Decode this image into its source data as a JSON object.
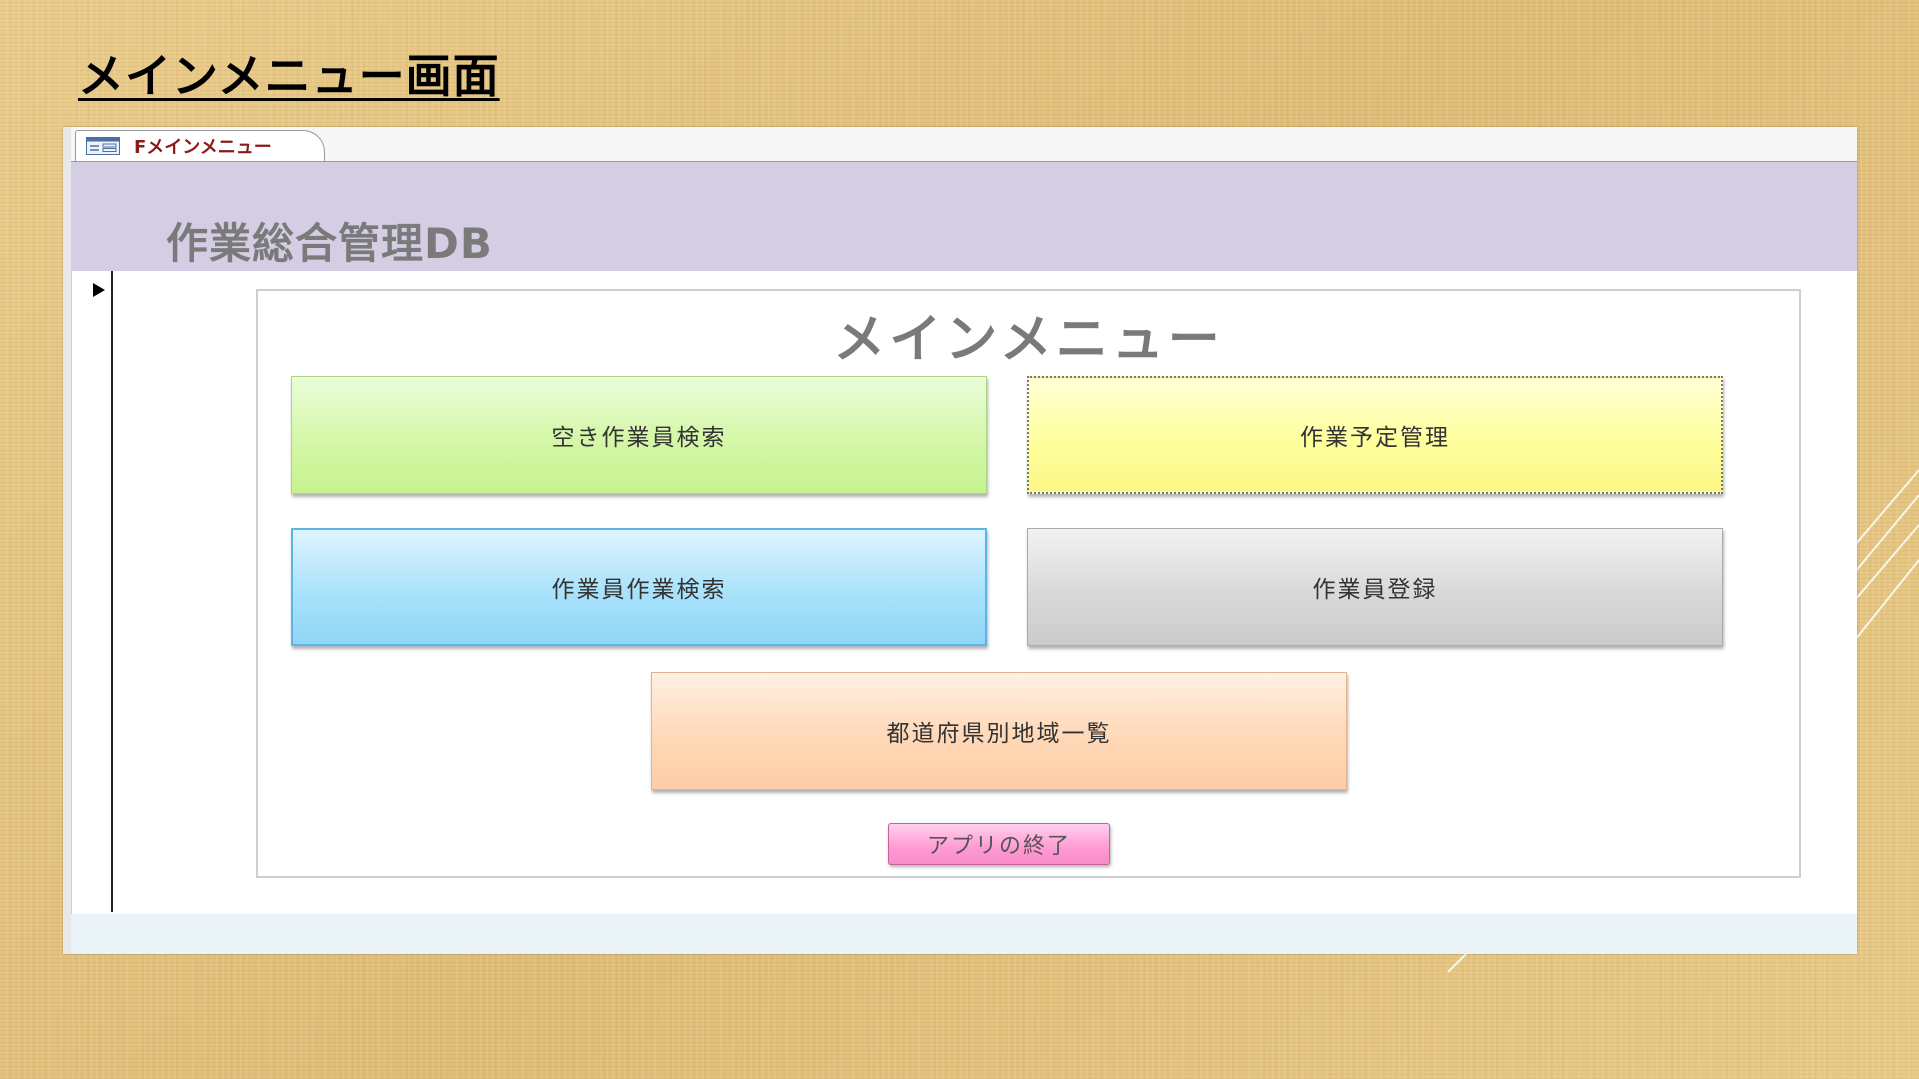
{
  "slide": {
    "title": "メインメニュー画面"
  },
  "window": {
    "tab_label": "Fメインメニュー",
    "app_title": "作業総合管理DB"
  },
  "menu": {
    "title": "メインメニュー",
    "buttons": [
      {
        "label": "空き作業員検索",
        "color": "#d4f7a8"
      },
      {
        "label": "作業予定管理",
        "color": "#ffff9e"
      },
      {
        "label": "作業員作業検索",
        "color": "#a9e2fb"
      },
      {
        "label": "作業員登録",
        "color": "#d9d9d9"
      },
      {
        "label": "都道府県別地域一覧",
        "color": "#ffd8b8"
      }
    ],
    "exit_label": "アプリの終了"
  },
  "colors": {
    "header_band": "#d4cde4",
    "tab_label": "#8b1a1a",
    "exit_button": "#ff9ad4"
  },
  "icons": [
    "form-icon",
    "record-selector-arrow-icon"
  ]
}
